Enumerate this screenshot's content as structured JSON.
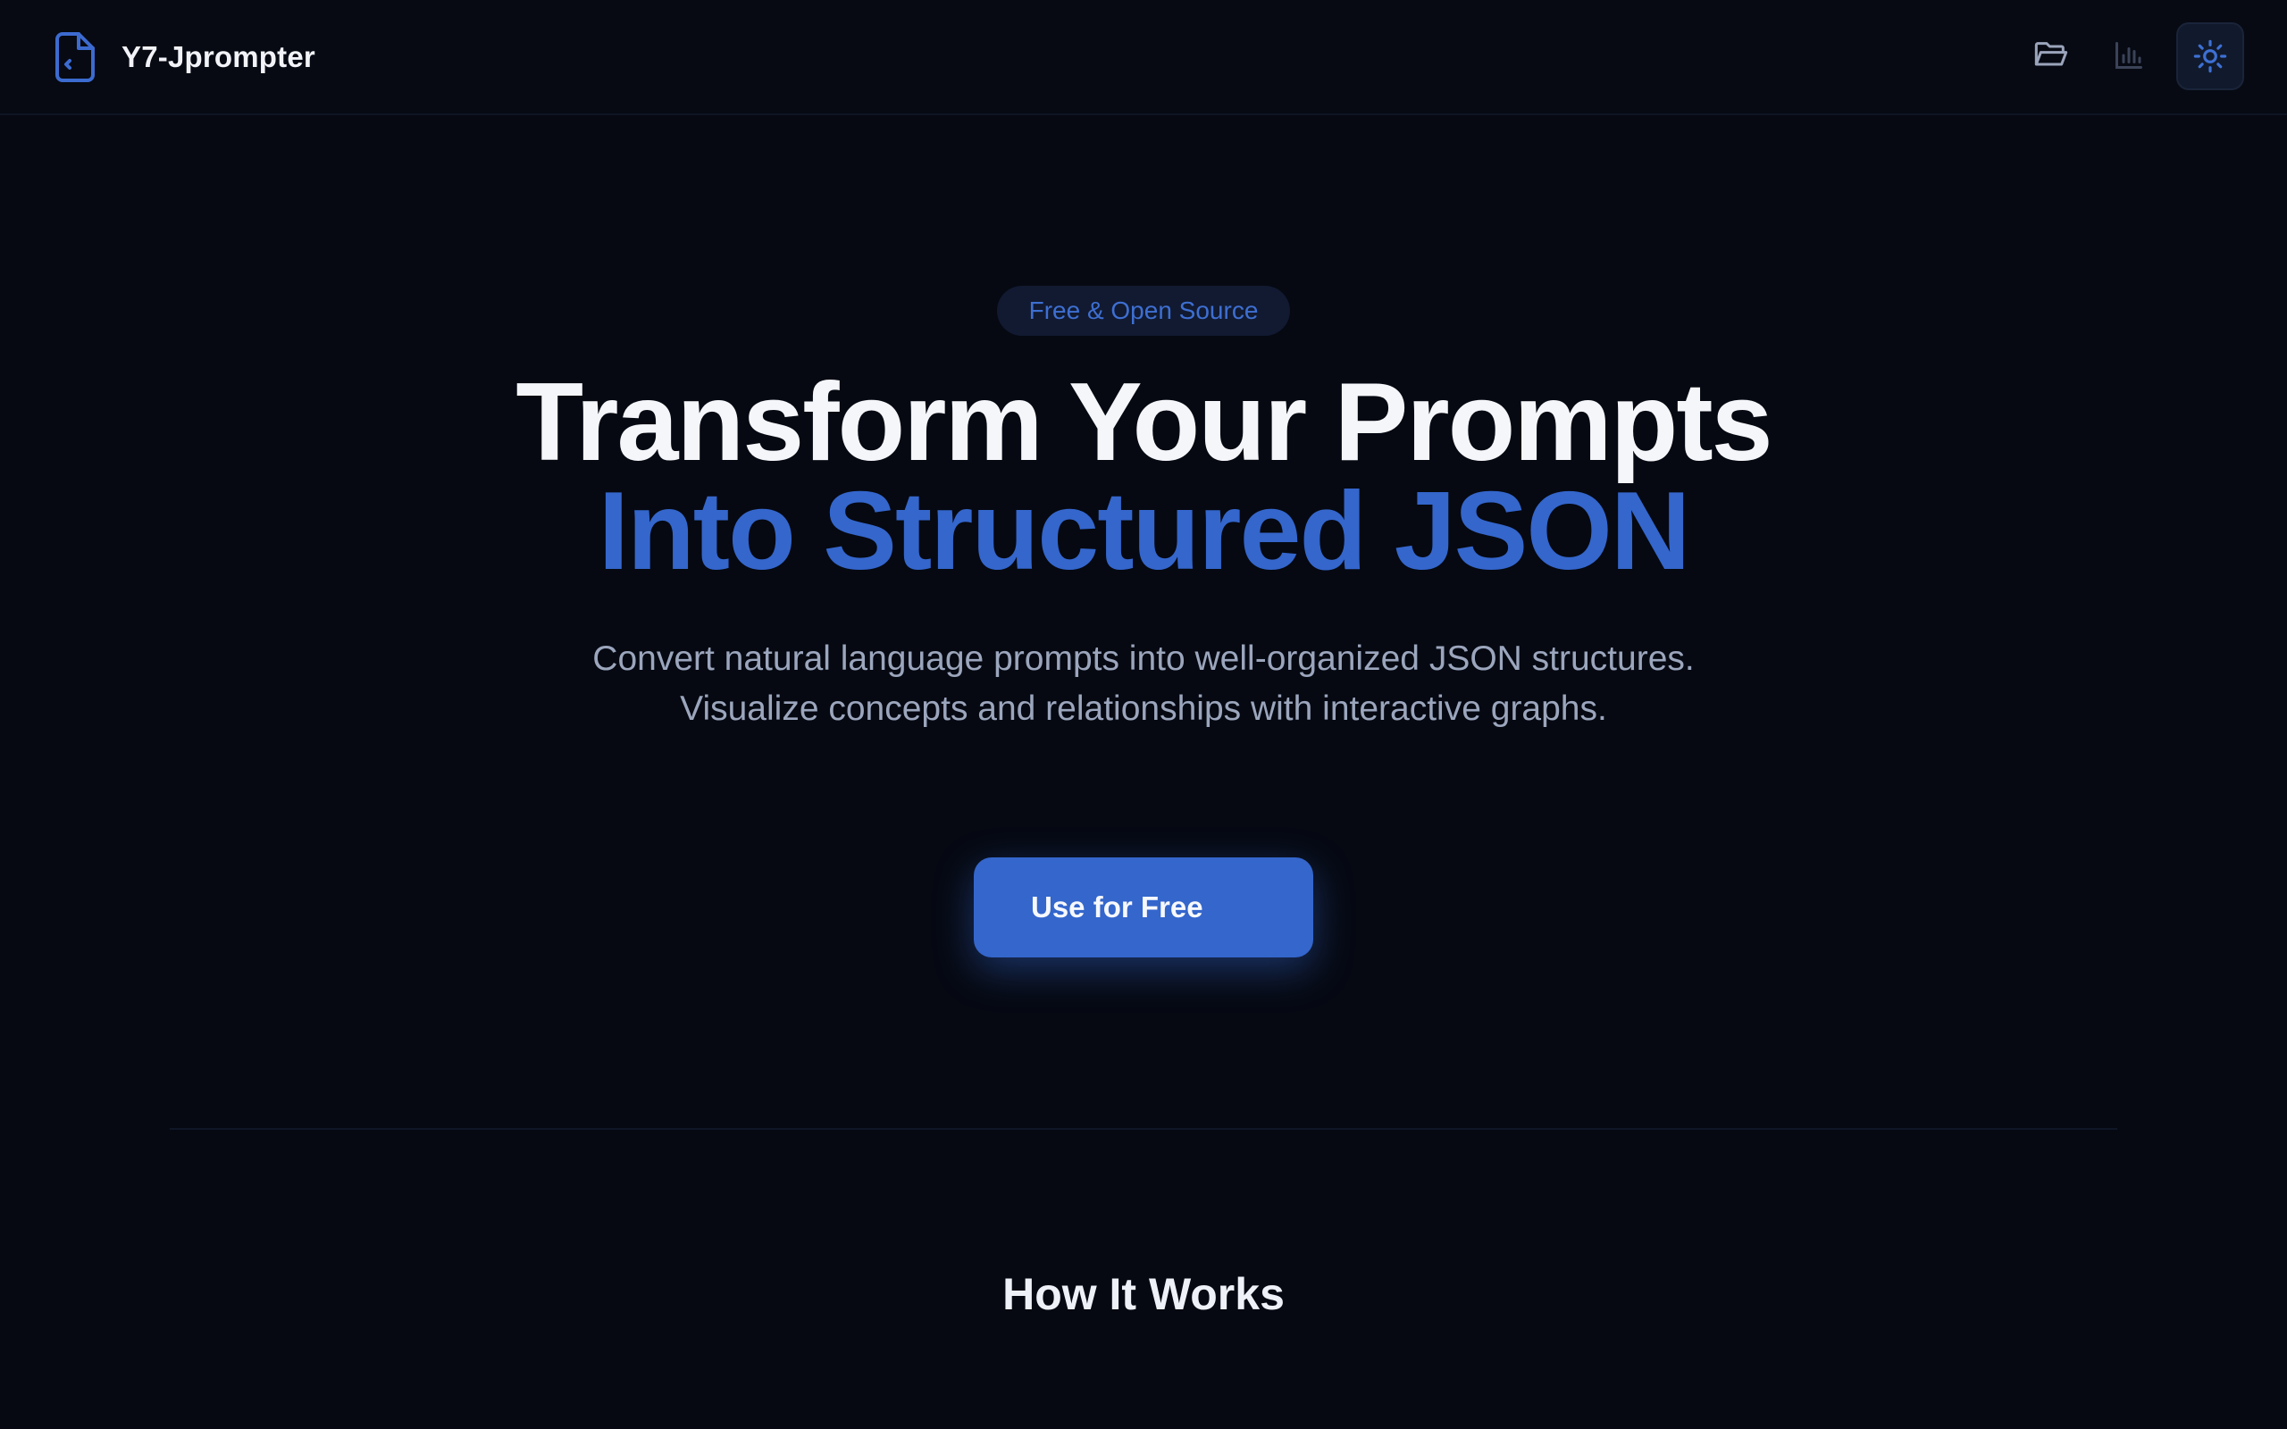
{
  "header": {
    "brand_name": "Y7-Jprompter",
    "icons": {
      "logo": "file-code-icon",
      "folder": "folder-open-icon",
      "chart": "bar-chart-icon",
      "theme": "sun-icon"
    }
  },
  "hero": {
    "badge": "Free & Open Source",
    "headline_line1": "Transform Your Prompts",
    "headline_line2": "Into Structured JSON",
    "subtitle": "Convert natural language prompts into well-organized JSON structures. Visualize concepts and relationships with interactive graphs.",
    "cta_label": "Use for Free"
  },
  "how_it_works": {
    "title": "How It Works"
  },
  "colors": {
    "background": "#060912",
    "accent": "#3466cc",
    "muted_text": "#9ba6bd"
  }
}
